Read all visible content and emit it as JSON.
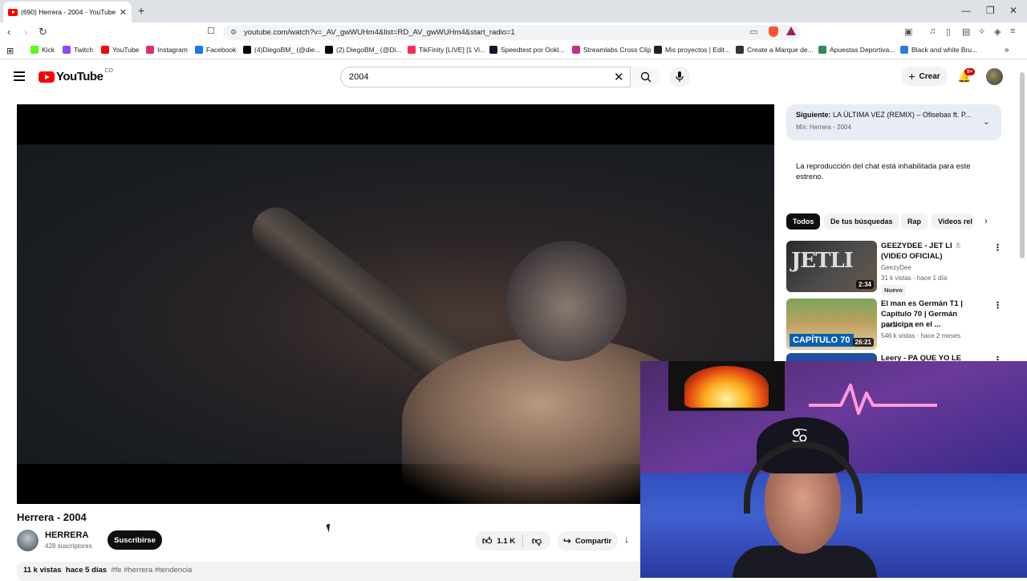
{
  "browser": {
    "tab_title": "(690) Herrera - 2004 - YouTube",
    "url": "youtube.com/watch?v=_AV_gwWUHm4&list=RD_AV_gwWUHm4&start_radio=1",
    "bookmarks": [
      {
        "label": "Kick",
        "color": "#53fc18"
      },
      {
        "label": "Twitch",
        "color": "#9146ff"
      },
      {
        "label": "YouTube",
        "color": "#ff0000"
      },
      {
        "label": "Instagram",
        "color": "#e1306c"
      },
      {
        "label": "Facebook",
        "color": "#1877f2"
      },
      {
        "label": "(4)DiegoBM_ (@die...",
        "color": "#000000"
      },
      {
        "label": "(2) DiegoBM_ (@Di...",
        "color": "#000000"
      },
      {
        "label": "TikFinity [LIVE] [1 Vi...",
        "color": "#ff2a55"
      },
      {
        "label": "Speedtest por Ookl...",
        "color": "#141526"
      },
      {
        "label": "Streamlabs Cross Clip",
        "color": "#c0328a"
      },
      {
        "label": "Mis proyectos | Edit...",
        "color": "#222222"
      },
      {
        "label": "Create a Marque de...",
        "color": "#333333"
      },
      {
        "label": "Apuestas Deportiva...",
        "color": "#2e8b57"
      },
      {
        "label": "Black and white Bru...",
        "color": "#2a7fd4"
      }
    ]
  },
  "header": {
    "logo_text": "YouTube",
    "country": "CO",
    "search_value": "2004",
    "create_label": "Crear",
    "notif_count": "9+"
  },
  "video": {
    "title": "Herrera - 2004",
    "channel": "HERRERA",
    "subscribers": "428 suscriptores",
    "subscribe_label": "Suscribirse",
    "likes": "1.1 K",
    "share_label": "Compartir",
    "views": "11 k vistas",
    "age": "hace 5 días",
    "tags": "#fe #herrera #tendencia"
  },
  "sidebar": {
    "next_label": "Siguiente:",
    "next_title": "LA ÚLTIMA VEZ (REMIX) – Ofisebas ft. P...",
    "next_mix": "Mix: Herrera - 2004",
    "chat_note": "La reproducción del chat está inhabilitada para este estreno.",
    "chips": [
      "Todos",
      "De tus búsquedas",
      "Rap",
      "Videos rel"
    ],
    "recs": [
      {
        "title": "GEEZYDEE - JET LI ☃ (VIDEO OFICIAL)",
        "channel": "GeezyDee",
        "views": "31 k vistas · hace 1 día",
        "duration": "2:34",
        "badge": "Nuevo",
        "thumb_text": "JETLI"
      },
      {
        "title": "El man es Germán T1 | Capítulo 70 | Germán participa en el ...",
        "channel": "Canal RCN",
        "views": "546 k vistas · hace 2 meses",
        "duration": "26:21",
        "thumb_text": "CAPÍTULO 70"
      },
      {
        "title": "Leery - PA QUE YO LE LLEGUE",
        "channel": "",
        "views": "",
        "duration": ""
      }
    ]
  }
}
